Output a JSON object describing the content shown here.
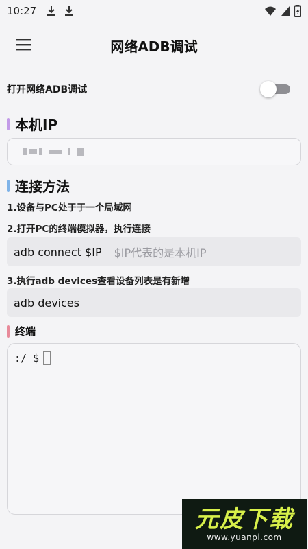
{
  "status_bar": {
    "time": "10:27",
    "icons": [
      "download-icon",
      "download-icon",
      "wifi-icon",
      "signal-icon",
      "battery-icon"
    ]
  },
  "app_bar": {
    "title": "网络ADB调试",
    "menu_icon": "hamburger-menu-icon"
  },
  "network_adb": {
    "label": "打开网络ADB调试",
    "enabled": false
  },
  "local_ip": {
    "title": "本机IP",
    "accent": "#c39be8"
  },
  "connection": {
    "title": "连接方法",
    "accent": "#7fb3e8",
    "step1": "1.设备与PC处于于一个局域网",
    "step2": "2.打开PC的终端模拟器，执行连接",
    "connect_cmd": "adb connect $IP",
    "connect_hint": "$IP代表的是本机IP",
    "step3": "3.执行adb devices查看设备列表是有新增",
    "devices_cmd": "adb devices"
  },
  "terminal": {
    "title": "终端",
    "accent": "#e88a9a",
    "prompt": ":/ $"
  },
  "watermark": {
    "brand": "元皮下载",
    "url": "www.yuanpi.com"
  }
}
